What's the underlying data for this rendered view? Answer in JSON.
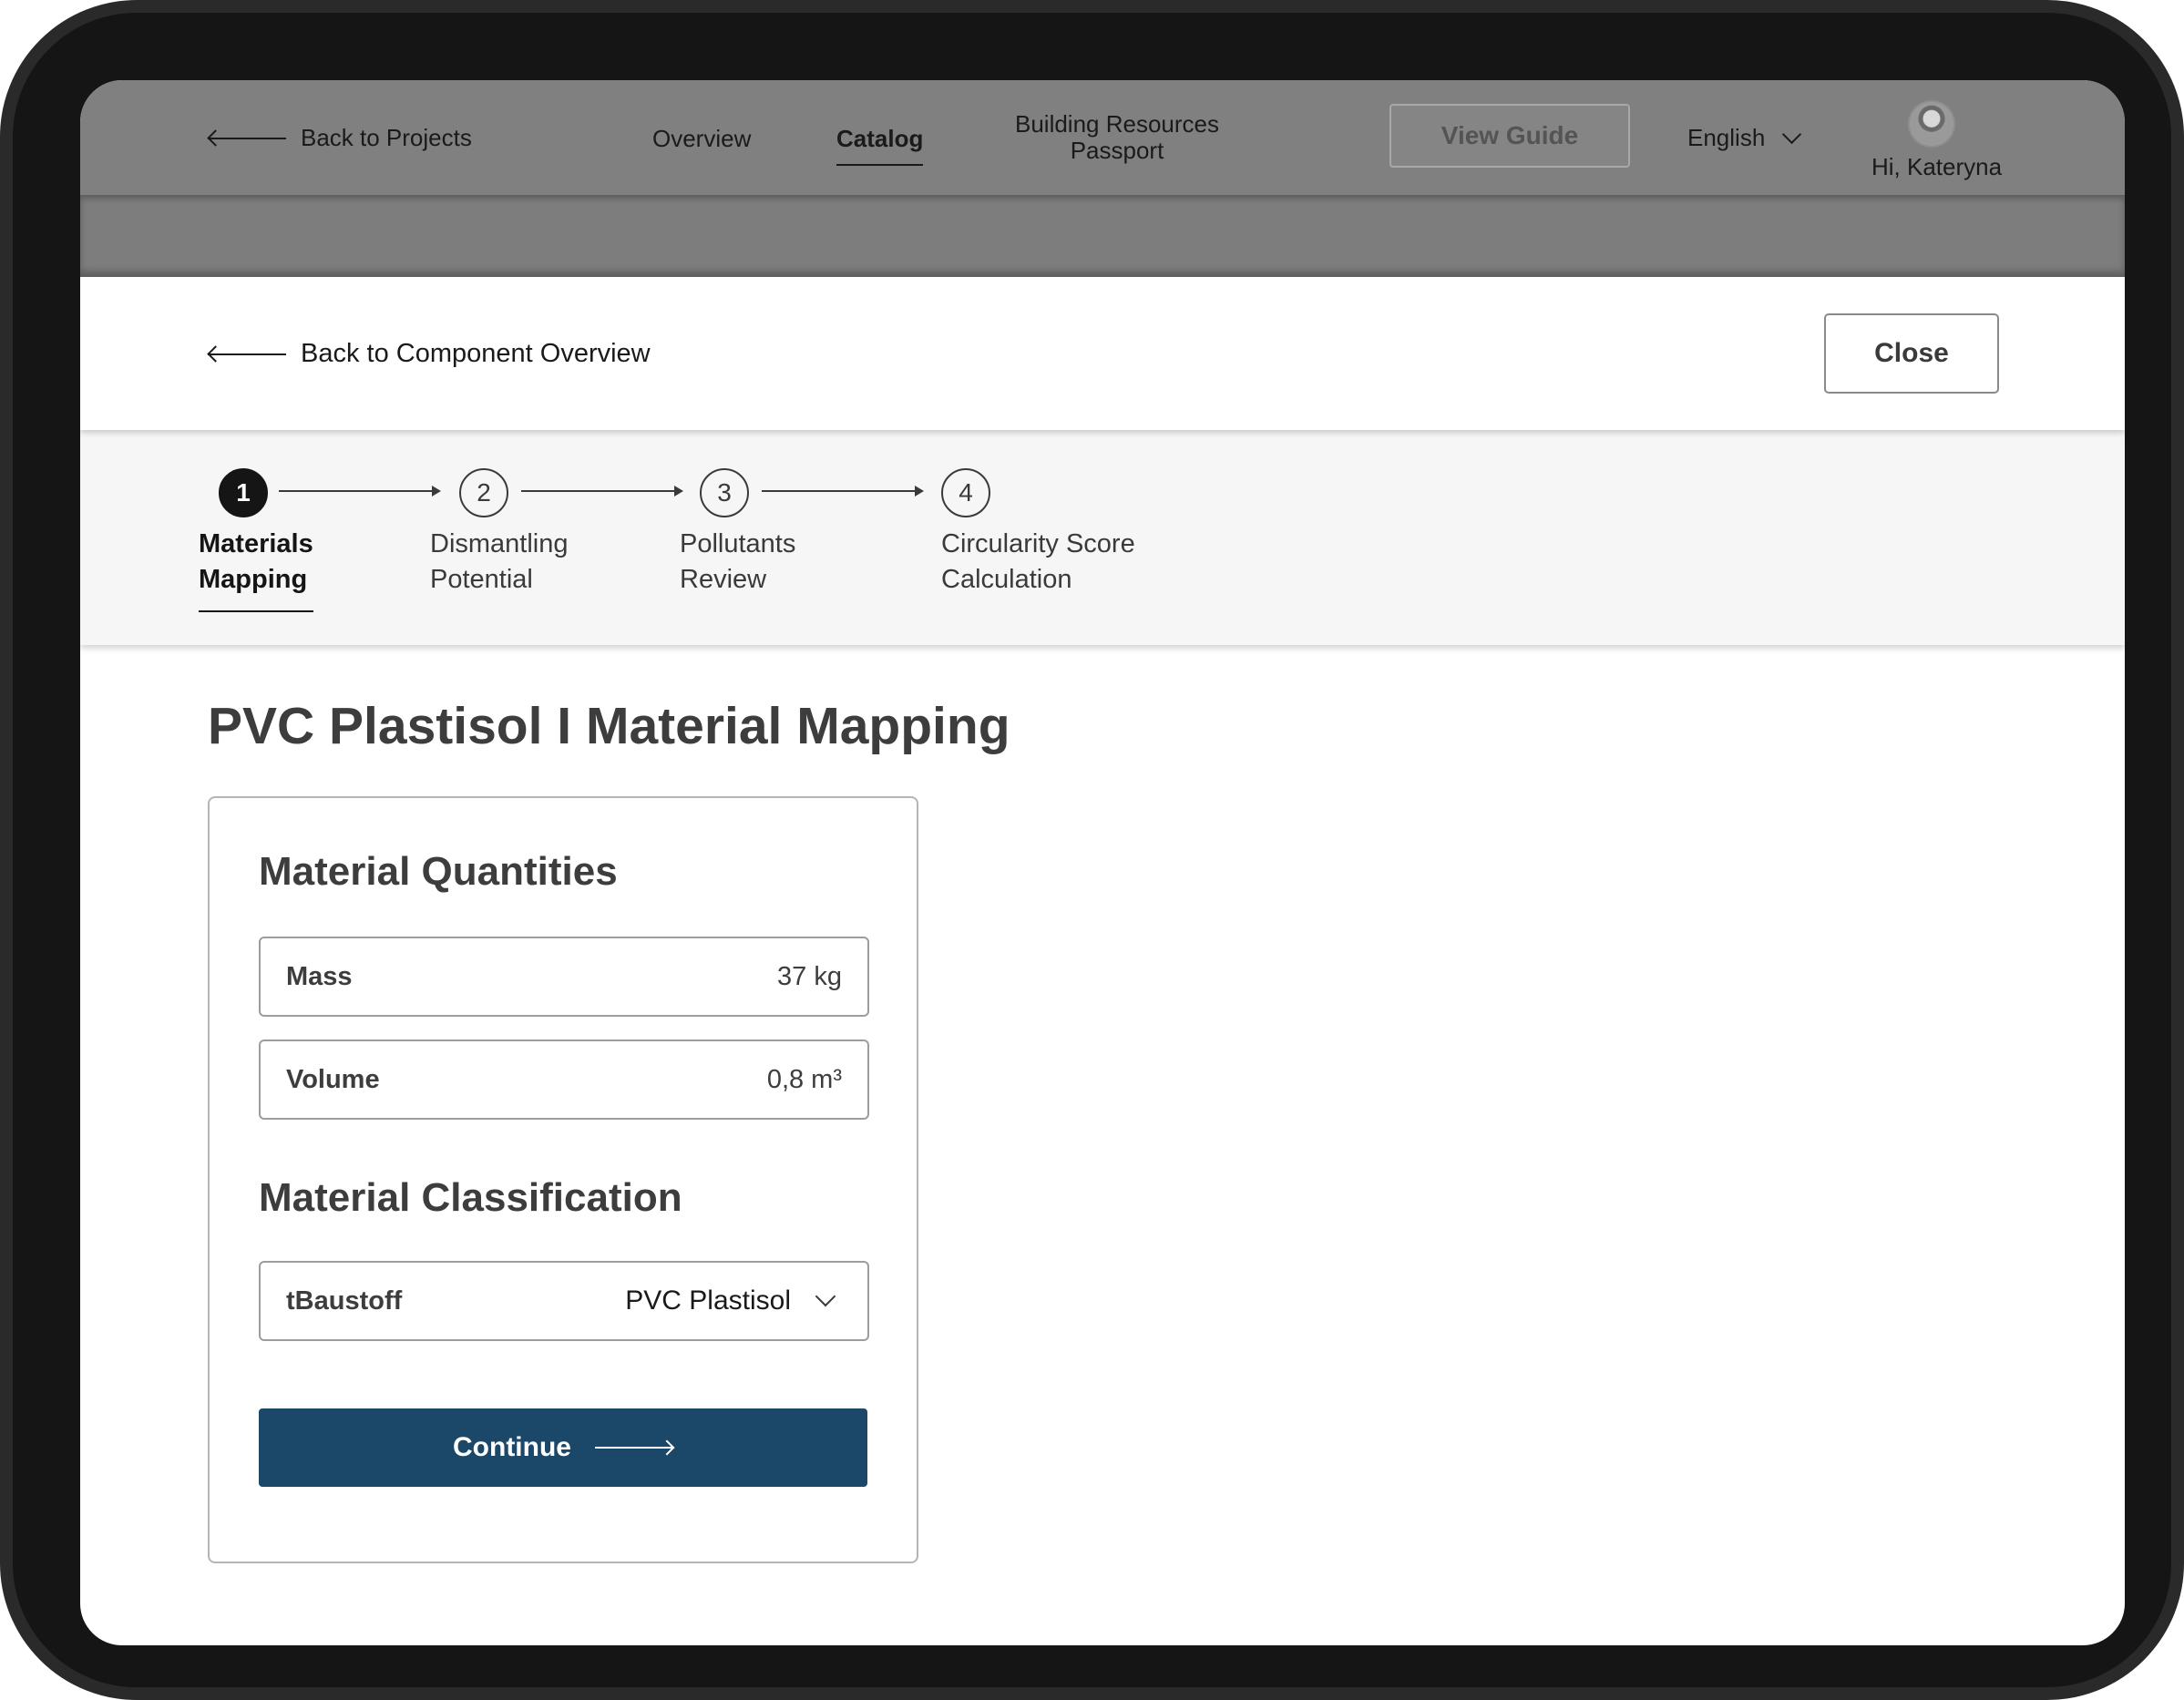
{
  "topnav": {
    "back_label": "Back to Projects",
    "links": [
      "Overview",
      "Catalog",
      "Building Resources Passport"
    ],
    "active_link": "Catalog",
    "view_guide_label": "View Guide",
    "language": "English",
    "greeting": "Hi, Kateryna"
  },
  "header": {
    "back_label": "Back to Component Overview",
    "close_label": "Close"
  },
  "stepper": {
    "active_step": 1,
    "steps": [
      {
        "number": "1",
        "label": "Materials Mapping",
        "line1": "Materials",
        "line2": "Mapping"
      },
      {
        "number": "2",
        "label": "Dismantling Potential",
        "line1": "Dismantling",
        "line2": "Potential"
      },
      {
        "number": "3",
        "label": "Pollutants Review",
        "line1": "Pollutants",
        "line2": "Review"
      },
      {
        "number": "4",
        "label": "Circularity Score Calculation",
        "line1": "Circularity Score",
        "line2": "Calculation"
      }
    ]
  },
  "page_title": "PVC Plastisol I Material Mapping",
  "card": {
    "quantities_heading": "Material Quantities",
    "mass": {
      "label": "Mass",
      "value": "37 kg"
    },
    "volume": {
      "label": "Volume",
      "value": "0,8 m³"
    },
    "classification_heading": "Material Classification",
    "classification": {
      "label": "tBaustoff",
      "value": "PVC Plastisol"
    },
    "continue_label": "Continue"
  },
  "colors": {
    "primary_button": "#1b4869",
    "nav_dimmed": "#808080",
    "stepper_bg": "#f6f6f6",
    "device_frame": "#151515"
  },
  "icons": [
    "arrow-left-icon",
    "chevron-down-icon",
    "avatar",
    "arrow-right-icon"
  ]
}
